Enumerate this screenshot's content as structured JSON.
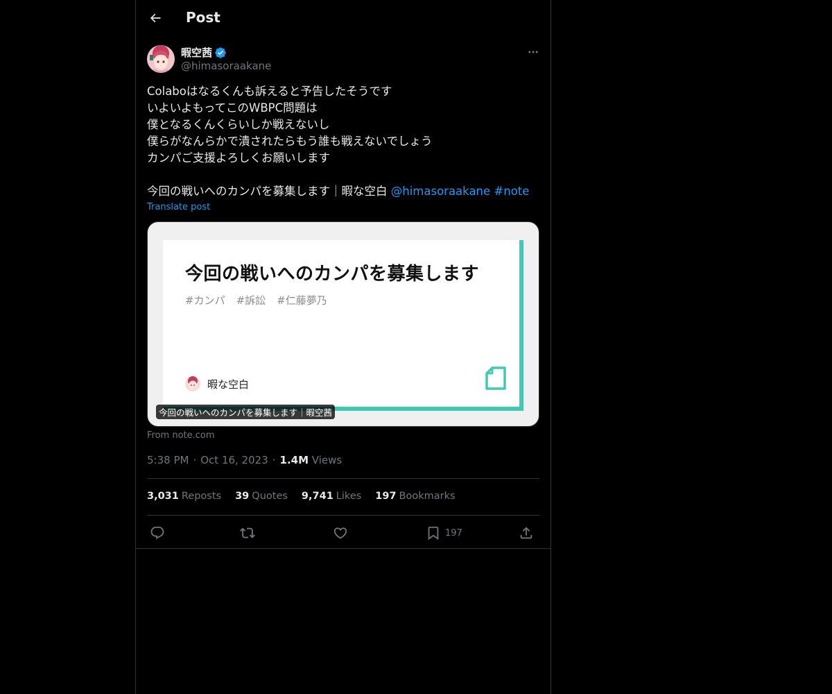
{
  "header": {
    "title": "Post"
  },
  "author": {
    "display_name": "暇空茜",
    "handle": "@himasoraakane",
    "verified": true
  },
  "tweet": {
    "lines": [
      "Colaboはなるくんも訴えると予告したそうです",
      "いよいよもってこのWBPC問題は",
      "僕となるくんくらいしか戦えないし",
      "僕らがなんらかで潰されたらもう誰も戦えないでしょう",
      "カンパご支援よろしくお願いします"
    ],
    "last_line_text": "今回の戦いへのカンパを募集します｜暇な空白",
    "mention": "@himasoraakane",
    "hashtag": "#note",
    "translate_label": "Translate post"
  },
  "card": {
    "title": "今回の戦いへのカンパを募集します",
    "tags": [
      "#カンパ",
      "#訴訟",
      "#仁藤夢乃"
    ],
    "author_name": "暇な空白",
    "caption": "今回の戦いへのカンパを募集します｜暇空茜",
    "domain_label": "From note.com"
  },
  "meta": {
    "time": "5:38 PM",
    "date": "Oct 16, 2023",
    "separator": "·",
    "views_count": "1.4M",
    "views_label": "Views"
  },
  "stats": {
    "reposts_count": "3,031",
    "reposts_label": "Reposts",
    "quotes_count": "39",
    "quotes_label": "Quotes",
    "likes_count": "9,741",
    "likes_label": "Likes",
    "bookmarks_count": "197",
    "bookmarks_label": "Bookmarks"
  },
  "actions": {
    "bookmark_count": "197"
  },
  "colors": {
    "background": "#000000",
    "text_primary": "#e7e9ea",
    "text_secondary": "#71767b",
    "link": "#1d9bf0",
    "border": "#2f3336",
    "note_accent": "#41c9b4"
  },
  "icons": {
    "back": "arrow-left-icon",
    "verified": "verified-badge-icon",
    "more": "more-horizontal-icon",
    "reply": "reply-icon",
    "repost": "repost-icon",
    "like": "heart-icon",
    "bookmark": "bookmark-icon",
    "share": "share-icon",
    "note": "note-logo-icon"
  }
}
